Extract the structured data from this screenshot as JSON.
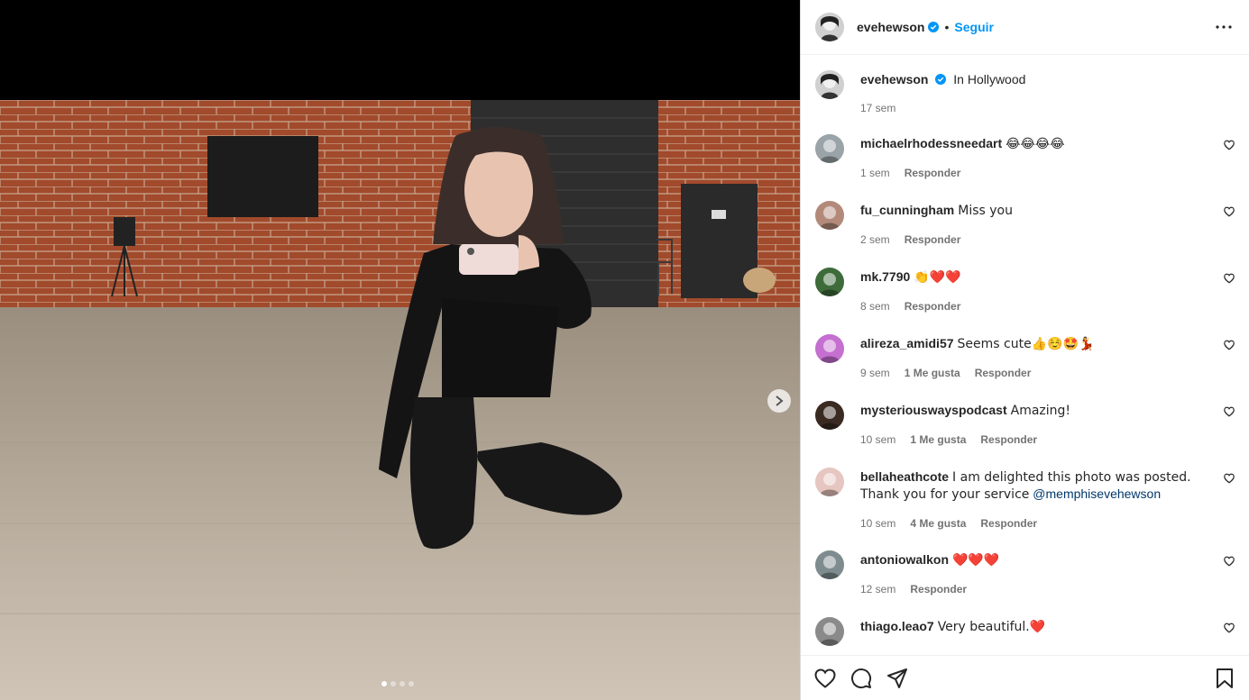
{
  "post": {
    "username": "evehewson",
    "follow_label": "Seguir",
    "separator": "•",
    "caption": "In Hollywood",
    "caption_time": "17 sem",
    "carousel": {
      "total": 4,
      "active": 1
    }
  },
  "comments": [
    {
      "username": "michaelrhodessneedart",
      "text": "😂😂😂😂",
      "time": "1 sem",
      "likes": "",
      "reply": "Responder",
      "avatar_color": "#9aa3a8"
    },
    {
      "username": "fu_cunningham",
      "text": "Miss you",
      "time": "2 sem",
      "likes": "",
      "reply": "Responder",
      "avatar_color": "#b38a7a"
    },
    {
      "username": "mk.7790",
      "text": "👏❤️❤️",
      "time": "8 sem",
      "likes": "",
      "reply": "Responder",
      "avatar_color": "#3d6b3a"
    },
    {
      "username": "alireza_amidi57",
      "text": "Seems cute👍☺️🤩💃",
      "time": "9 sem",
      "likes": "1 Me gusta",
      "reply": "Responder",
      "avatar_color": "#c56fd1"
    },
    {
      "username": "mysteriouswayspodcast",
      "text": "Amazing!",
      "time": "10 sem",
      "likes": "1 Me gusta",
      "reply": "Responder",
      "avatar_color": "#3a2a22"
    },
    {
      "username": "bellaheathcote",
      "text": "I am delighted this photo was posted. Thank you for your service",
      "mention": "@memphisevehewson",
      "time": "10 sem",
      "likes": "4 Me gusta",
      "reply": "Responder",
      "avatar_color": "#e6c6c0"
    },
    {
      "username": "antoniowalkon",
      "text": "❤️❤️❤️",
      "time": "12 sem",
      "likes": "",
      "reply": "Responder",
      "avatar_color": "#7f8c8f"
    },
    {
      "username": "thiago.leao7",
      "text": "Very beautiful.❤️",
      "time": "",
      "likes": "",
      "reply": "",
      "avatar_color": "#8a8a8a"
    }
  ],
  "icons": {
    "like": "heart-icon",
    "comment": "comment-icon",
    "share": "share-icon",
    "save": "bookmark-icon",
    "more": "more-options-icon"
  },
  "colors": {
    "accent": "#0095f6",
    "verified": "#0095f6",
    "text": "#262626",
    "muted": "#737373"
  }
}
